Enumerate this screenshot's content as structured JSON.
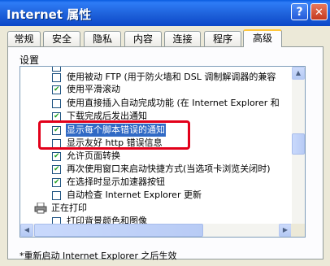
{
  "window": {
    "title": "Internet 属性",
    "help_label": "?",
    "close_label": "✕"
  },
  "tabs": [
    {
      "label": "常规"
    },
    {
      "label": "安全"
    },
    {
      "label": "隐私"
    },
    {
      "label": "内容"
    },
    {
      "label": "连接"
    },
    {
      "label": "程序"
    },
    {
      "label": "高级",
      "active": true
    }
  ],
  "settings": {
    "label": "设置",
    "items": [
      {
        "label": "",
        "checked": false
      },
      {
        "label": "使用被动 FTP (用于防火墙和 DSL 调制解调器的兼容",
        "checked": false
      },
      {
        "label": "使用平滑滚动",
        "checked": true
      },
      {
        "label": "使用直接插入自动完成功能 (在 Internet Explorer 和",
        "checked": false
      },
      {
        "label": "下载完成后发出通知",
        "checked": true
      },
      {
        "label": "显示每个脚本错误的通知",
        "checked": true,
        "selected": true
      },
      {
        "label": "显示友好 http 错误信息",
        "checked": false
      },
      {
        "label": "允许页面转换",
        "checked": true
      },
      {
        "label": "再次使用窗口来启动快捷方式(当选项卡浏览关闭时)",
        "checked": true
      },
      {
        "label": "在选择时显示加速器按钮",
        "checked": true
      },
      {
        "label": "自动检查 Internet Explorer 更新",
        "checked": false
      }
    ],
    "group_label": "正在打印",
    "print_item": {
      "label": "打印背景颜色和图像",
      "checked": false
    }
  },
  "footnote": "*重新启动 Internet Explorer 之后生效",
  "colors": {
    "highlight": "#E2001A",
    "selection": "#316AC5",
    "titlebar": "#0A5CE0"
  }
}
